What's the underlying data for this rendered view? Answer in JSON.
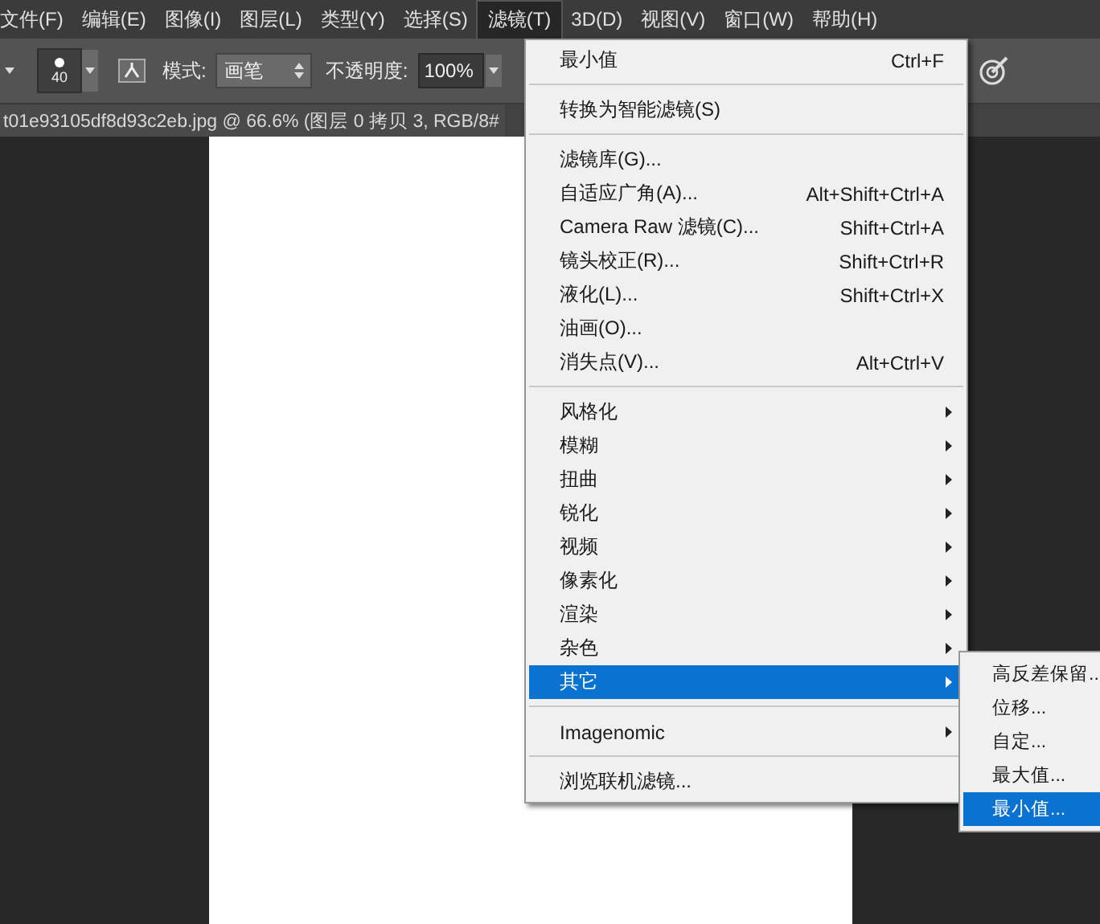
{
  "menu_bar": [
    {
      "label": "文件(F)",
      "selected": false
    },
    {
      "label": "编辑(E)",
      "selected": false
    },
    {
      "label": "图像(I)",
      "selected": false
    },
    {
      "label": "图层(L)",
      "selected": false
    },
    {
      "label": "类型(Y)",
      "selected": false
    },
    {
      "label": "选择(S)",
      "selected": false
    },
    {
      "label": "滤镜(T)",
      "selected": true
    },
    {
      "label": "3D(D)",
      "selected": false
    },
    {
      "label": "视图(V)",
      "selected": false
    },
    {
      "label": "窗口(W)",
      "selected": false
    },
    {
      "label": "帮助(H)",
      "selected": false
    }
  ],
  "options_bar": {
    "brush_size": "40",
    "mode_label": "模式:",
    "mode_value": "画笔",
    "opacity_label": "不透明度:",
    "opacity_value": "100%"
  },
  "document_tab": {
    "title": "t01e93105df8d93c2eb.jpg @ 66.6% (图层 0 拷贝 3, RGB/8#"
  },
  "filter_menu": {
    "groups": [
      [
        {
          "label": "最小值",
          "shortcut": "Ctrl+F",
          "has_submenu": false,
          "selected": false
        }
      ],
      [
        {
          "label": "转换为智能滤镜(S)",
          "has_submenu": false,
          "selected": false
        }
      ],
      [
        {
          "label": "滤镜库(G)...",
          "has_submenu": false,
          "selected": false
        },
        {
          "label": "自适应广角(A)...",
          "shortcut": "Alt+Shift+Ctrl+A",
          "has_submenu": false,
          "selected": false
        },
        {
          "label": "Camera Raw 滤镜(C)...",
          "shortcut": "Shift+Ctrl+A",
          "has_submenu": false,
          "selected": false
        },
        {
          "label": "镜头校正(R)...",
          "shortcut": "Shift+Ctrl+R",
          "has_submenu": false,
          "selected": false
        },
        {
          "label": "液化(L)...",
          "shortcut": "Shift+Ctrl+X",
          "has_submenu": false,
          "selected": false
        },
        {
          "label": "油画(O)...",
          "has_submenu": false,
          "selected": false
        },
        {
          "label": "消失点(V)...",
          "shortcut": "Alt+Ctrl+V",
          "has_submenu": false,
          "selected": false
        }
      ],
      [
        {
          "label": "风格化",
          "has_submenu": true,
          "selected": false
        },
        {
          "label": "模糊",
          "has_submenu": true,
          "selected": false
        },
        {
          "label": "扭曲",
          "has_submenu": true,
          "selected": false
        },
        {
          "label": "锐化",
          "has_submenu": true,
          "selected": false
        },
        {
          "label": "视频",
          "has_submenu": true,
          "selected": false
        },
        {
          "label": "像素化",
          "has_submenu": true,
          "selected": false
        },
        {
          "label": "渲染",
          "has_submenu": true,
          "selected": false
        },
        {
          "label": "杂色",
          "has_submenu": true,
          "selected": false
        },
        {
          "label": "其它",
          "has_submenu": true,
          "selected": true
        }
      ],
      [
        {
          "label": "Imagenomic",
          "has_submenu": true,
          "selected": false
        }
      ],
      [
        {
          "label": "浏览联机滤镜...",
          "has_submenu": false,
          "selected": false
        }
      ]
    ]
  },
  "other_submenu": {
    "items": [
      {
        "label": "高反差保留..",
        "selected": false
      },
      {
        "label": "位移...",
        "selected": false
      },
      {
        "label": "自定...",
        "selected": false
      },
      {
        "label": "最大值...",
        "selected": false
      },
      {
        "label": "最小值...",
        "selected": true
      }
    ]
  }
}
